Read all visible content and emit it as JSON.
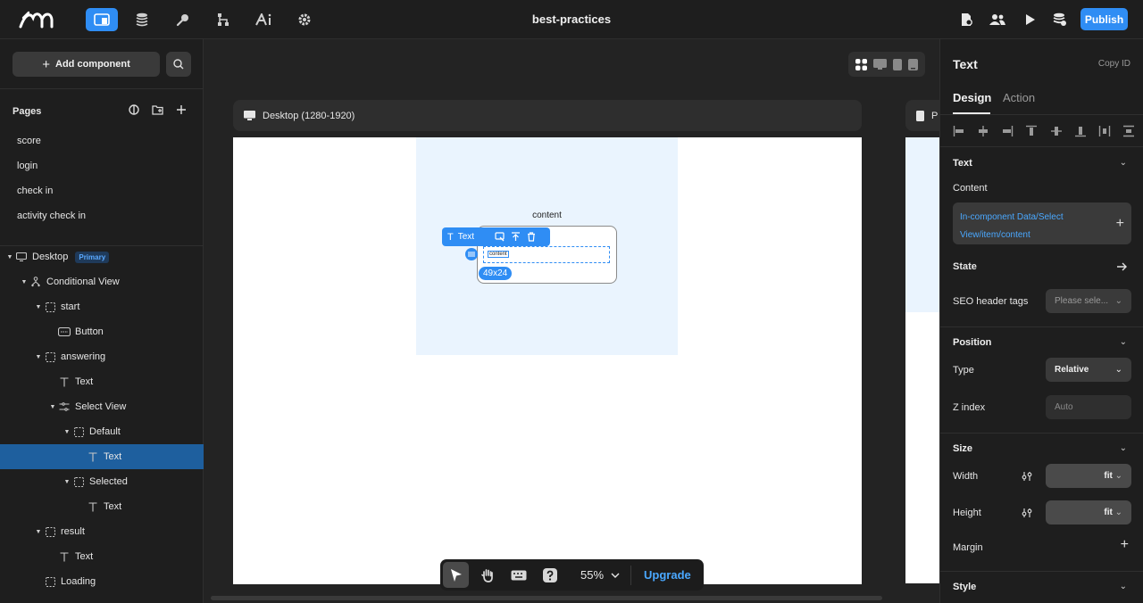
{
  "app": {
    "title": "best-practices",
    "publish_label": "Publish",
    "nav_icons": [
      "pages-icon",
      "database-icon",
      "integrations-icon",
      "workflow-icon",
      "ai-icon",
      "gear-icon"
    ],
    "right_icons": [
      "document-settings-icon",
      "users-icon",
      "play-icon",
      "database-settings-icon"
    ]
  },
  "sidebar": {
    "add_component_label": "Add component",
    "pages_title": "Pages",
    "pages": [
      "score",
      "login",
      "check in",
      "activity check in"
    ],
    "tree": [
      {
        "label": "Desktop",
        "badge": "Primary",
        "depth": 0,
        "icon": "desktop",
        "caret": true
      },
      {
        "label": "Conditional View",
        "depth": 1,
        "icon": "conditional",
        "caret": true
      },
      {
        "label": "start",
        "depth": 2,
        "icon": "frame",
        "caret": true
      },
      {
        "label": "Button",
        "depth": 3,
        "icon": "button",
        "caret": false
      },
      {
        "label": "answering",
        "depth": 2,
        "icon": "frame",
        "caret": true
      },
      {
        "label": "Text",
        "depth": 3,
        "icon": "text",
        "caret": false
      },
      {
        "label": "Select View",
        "depth": 3,
        "icon": "select",
        "caret": true
      },
      {
        "label": "Default",
        "depth": 4,
        "icon": "frame",
        "caret": true
      },
      {
        "label": "Text",
        "depth": 5,
        "icon": "text",
        "caret": false,
        "selected": true
      },
      {
        "label": "Selected",
        "depth": 4,
        "icon": "frame",
        "caret": true
      },
      {
        "label": "Text",
        "depth": 5,
        "icon": "text",
        "caret": false
      },
      {
        "label": "result",
        "depth": 2,
        "icon": "frame",
        "caret": true
      },
      {
        "label": "Text",
        "depth": 3,
        "icon": "text",
        "caret": false
      },
      {
        "label": "Loading",
        "depth": 2,
        "icon": "frame",
        "caret": false
      }
    ]
  },
  "canvas": {
    "frame_label": "Desktop (1280-1920)",
    "frame2_label": "P",
    "content_label": "content",
    "element_toolbar_label": "Text",
    "chip_text": "content",
    "dim_badge": "49x24",
    "zoom": "55%",
    "upgrade_label": "Upgrade"
  },
  "panel": {
    "title": "Text",
    "copy_id": "Copy ID",
    "tabs": [
      "Design",
      "Action"
    ],
    "text_section": "Text",
    "content_label": "Content",
    "content_value": "In-component Data/Select View/item/content",
    "state_label": "State",
    "seo_label": "SEO header tags",
    "seo_value": "Please sele...",
    "position_section": "Position",
    "type_label": "Type",
    "type_value": "Relative",
    "z_label": "Z index",
    "z_placeholder": "Auto",
    "size_section": "Size",
    "width_label": "Width",
    "width_value": "fit",
    "height_label": "Height",
    "height_value": "fit",
    "margin_label": "Margin",
    "style_section": "Style"
  },
  "colors": {
    "accent": "#2f8df4",
    "selected_row": "#1e5f9e",
    "link": "#4aa8ff"
  }
}
